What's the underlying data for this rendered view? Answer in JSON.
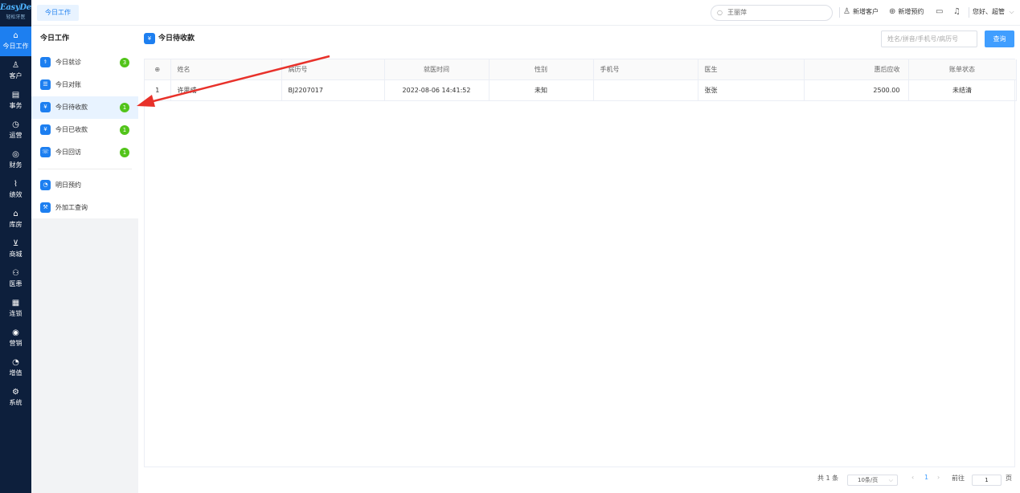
{
  "brand": {
    "name": "EasyDent",
    "subtitle": "轻松牙医"
  },
  "leftnav": [
    {
      "label": "今日工作",
      "icon": "home-icon",
      "glyph": "⌂",
      "active": true
    },
    {
      "label": "客户",
      "icon": "user-icon",
      "glyph": "♙"
    },
    {
      "label": "事务",
      "icon": "task-icon",
      "glyph": "▤"
    },
    {
      "label": "运营",
      "icon": "clock-icon",
      "glyph": "◷"
    },
    {
      "label": "财务",
      "icon": "finance-icon",
      "glyph": "◎"
    },
    {
      "label": "绩效",
      "icon": "chart-icon",
      "glyph": "⌇"
    },
    {
      "label": "库房",
      "icon": "warehouse-icon",
      "glyph": "⌂"
    },
    {
      "label": "商城",
      "icon": "cart-icon",
      "glyph": "⊻"
    },
    {
      "label": "医患",
      "icon": "people-icon",
      "glyph": "⚇"
    },
    {
      "label": "连锁",
      "icon": "chain-icon",
      "glyph": "▦"
    },
    {
      "label": "营销",
      "icon": "marketing-icon",
      "glyph": "◉"
    },
    {
      "label": "增值",
      "icon": "value-icon",
      "glyph": "◔"
    },
    {
      "label": "系统",
      "icon": "gear-icon",
      "glyph": "⚙"
    }
  ],
  "topbar": {
    "tab": "今日工作",
    "search_value": "王丽萍",
    "new_customer": "新增客户",
    "new_appointment": "新增预约",
    "greeting": "您好、超管"
  },
  "submenu": {
    "title": "今日工作",
    "items": [
      {
        "label": "今日就诊",
        "badge": "3"
      },
      {
        "label": "今日对账"
      },
      {
        "label": "今日待收款",
        "badge": "1",
        "active": true
      },
      {
        "label": "今日已收款",
        "badge": "1"
      },
      {
        "label": "今日回访",
        "badge": "1"
      },
      {
        "label": "明日预约"
      },
      {
        "label": "外加工查询"
      }
    ]
  },
  "main": {
    "title": "今日待收款",
    "query_placeholder": "姓名/拼音/手机号/病历号",
    "query_button": "查询",
    "columns": [
      "姓名",
      "病历号",
      "就医时间",
      "性别",
      "手机号",
      "医生",
      "惠后应收",
      "账单状态"
    ],
    "rows": [
      {
        "index": "1",
        "name": "许思成",
        "record_no": "BJ2207017",
        "visit_time": "2022-08-06 14:41:52",
        "gender": "未知",
        "phone": "",
        "doctor": "张张",
        "amount": "2500.00",
        "status": "未结清"
      }
    ]
  },
  "pagination": {
    "total": "共 1 条",
    "page_size": "10条/页",
    "current_page": "1",
    "goto_label": "前往",
    "goto_value": "1",
    "page_suffix": "页"
  },
  "colors": {
    "nav_bg": "#0d1f3c",
    "accent": "#1d7ff0",
    "badge": "#52c41a",
    "arrow": "#e8312a"
  }
}
